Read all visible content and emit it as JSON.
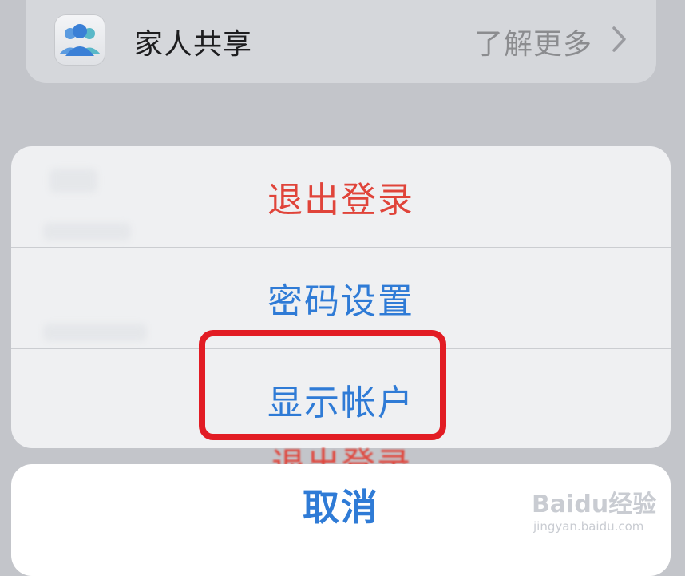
{
  "family_sharing": {
    "label": "家人共享",
    "link_label": "了解更多",
    "icon": "family-people-icon"
  },
  "action_sheet": {
    "items": [
      {
        "label": "退出登录",
        "color": "#e0443a",
        "role": "destructive"
      },
      {
        "label": "密码设置",
        "color": "#2f7bd6",
        "role": "default"
      },
      {
        "label": "显示帐户",
        "color": "#2f7bd6",
        "role": "default",
        "highlighted": true
      }
    ],
    "behind_text": "退出登录"
  },
  "cancel": {
    "label": "取消",
    "color": "#2f7bd6"
  },
  "watermark": {
    "logo": "Baidu经验",
    "sub": "jingyan.baidu.com"
  },
  "colors": {
    "background": "#c3c5ca",
    "sheet": "#eff0f2",
    "highlight_border": "#e21c24"
  }
}
